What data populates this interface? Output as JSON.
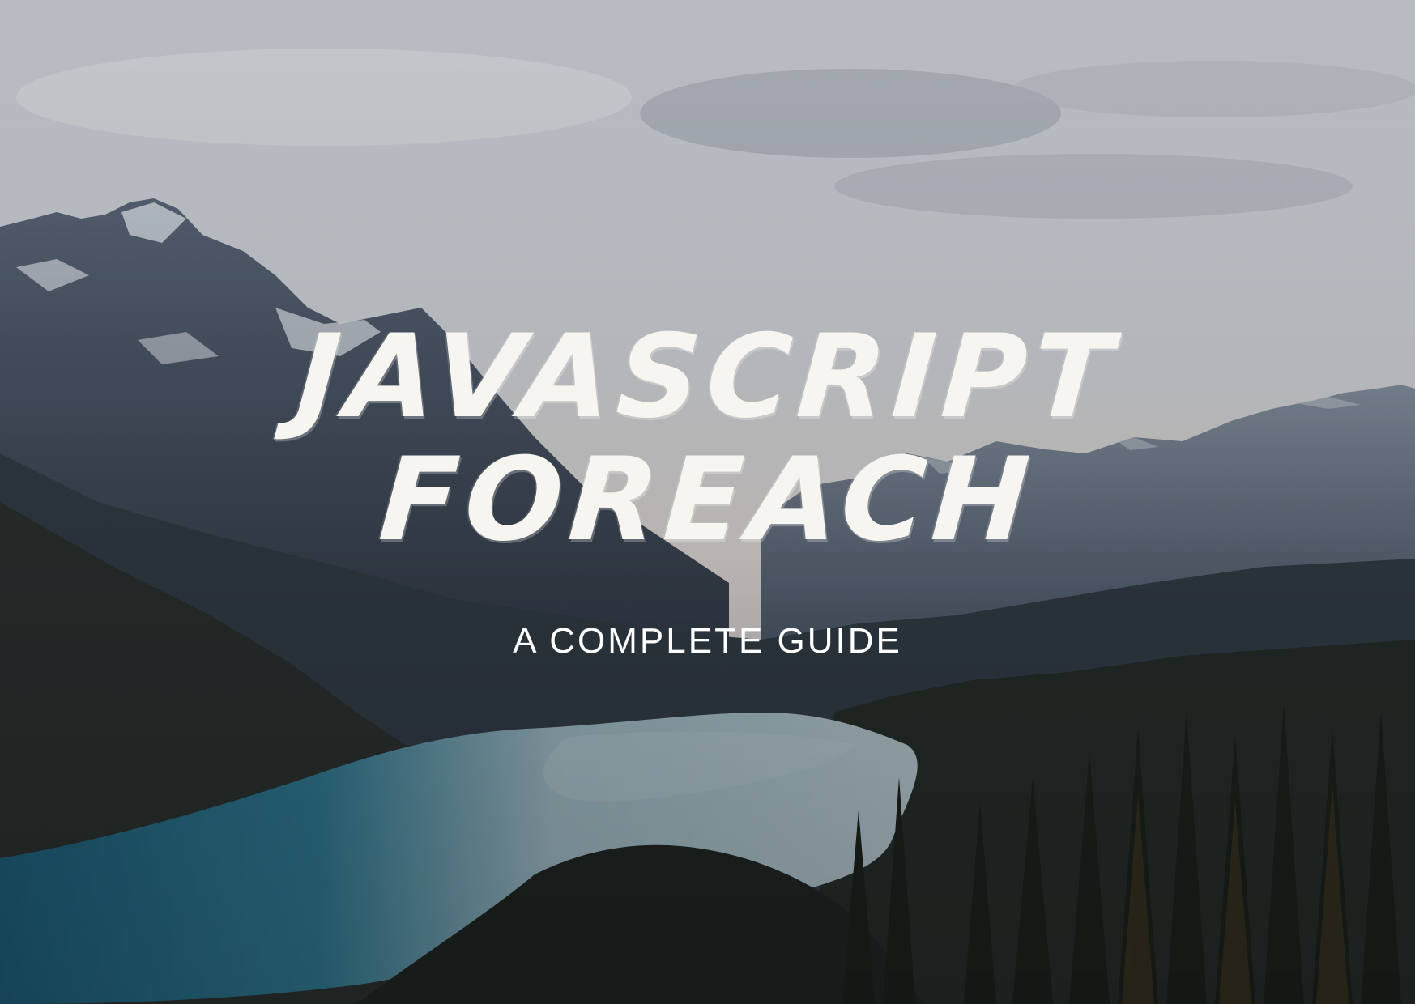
{
  "cover": {
    "title_line_1": "JAVASCRIPT",
    "title_line_2": "FOREACH",
    "subtitle": "A COMPLETE GUIDE"
  },
  "colors": {
    "sky_top": "#c9ccd2",
    "sky_horizon": "#e4ddd8",
    "mountain_far": "#6b7788",
    "mountain_near": "#3e4757",
    "forest": "#1f2620",
    "lake": "#2f7890",
    "lake_light": "#a9c3cc",
    "title_text": "#f7f5f0"
  }
}
